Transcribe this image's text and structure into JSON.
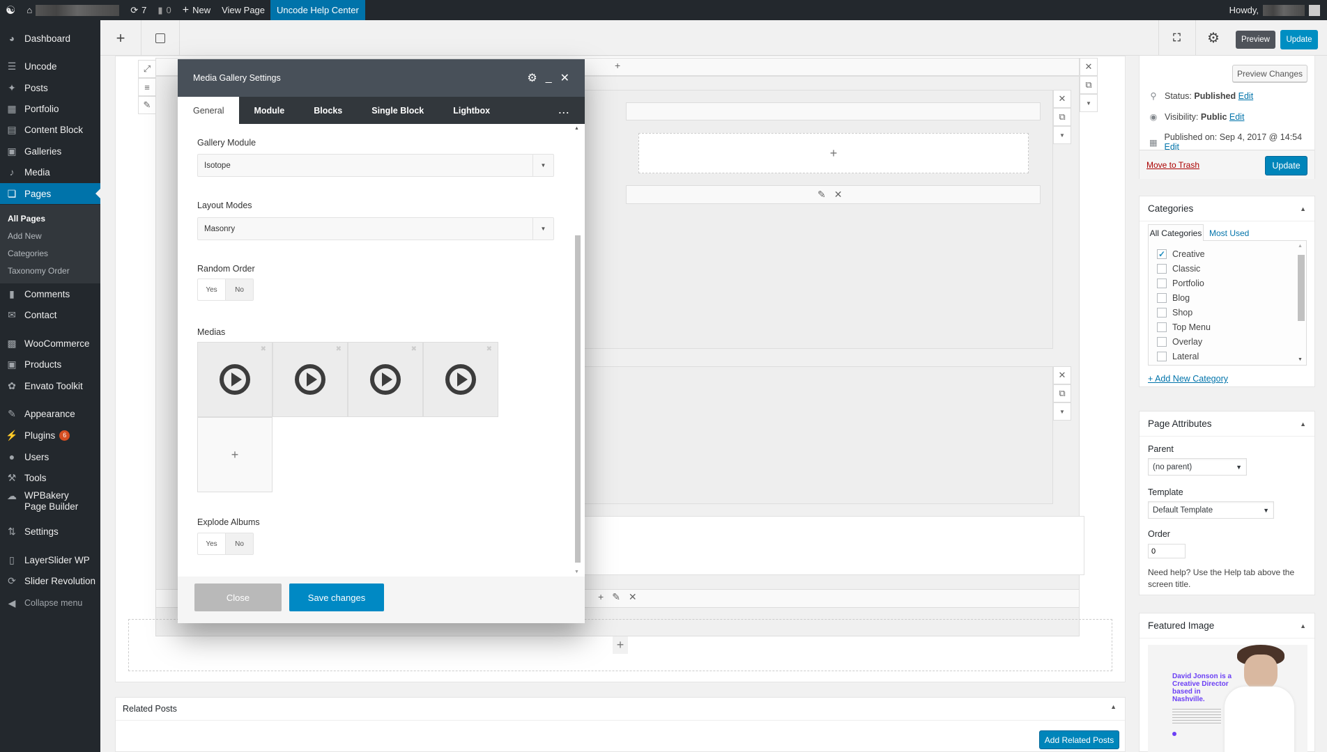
{
  "adminbar": {
    "updates_count": "7",
    "comments_count": "0",
    "new_label": "New",
    "view_page_label": "View Page",
    "help_center_label": "Uncode Help Center",
    "howdy_label": "Howdy,"
  },
  "sidebar": {
    "items": [
      {
        "label": "Dashboard",
        "icon": "dashboard-icon"
      },
      {
        "label": "Uncode",
        "icon": "layers-icon"
      },
      {
        "label": "Posts",
        "icon": "pin-icon"
      },
      {
        "label": "Portfolio",
        "icon": "portfolio-icon"
      },
      {
        "label": "Content Block",
        "icon": "content-block-icon"
      },
      {
        "label": "Galleries",
        "icon": "gallery-icon"
      },
      {
        "label": "Media",
        "icon": "media-icon"
      },
      {
        "label": "Pages",
        "icon": "pages-icon"
      },
      {
        "label": "Comments",
        "icon": "comment-icon"
      },
      {
        "label": "Contact",
        "icon": "mail-icon"
      },
      {
        "label": "WooCommerce",
        "icon": "woo-icon"
      },
      {
        "label": "Products",
        "icon": "box-icon"
      },
      {
        "label": "Envato Toolkit",
        "icon": "leaf-icon"
      },
      {
        "label": "Appearance",
        "icon": "brush-icon"
      },
      {
        "label": "Plugins",
        "icon": "plug-icon",
        "badge": "6"
      },
      {
        "label": "Users",
        "icon": "user-icon"
      },
      {
        "label": "Tools",
        "icon": "wrench-icon"
      },
      {
        "label": "WPBakery Page Builder",
        "icon": "cloud-icon"
      },
      {
        "label": "Settings",
        "icon": "settings-icon"
      },
      {
        "label": "LayerSlider WP",
        "icon": "slides-icon"
      },
      {
        "label": "Slider Revolution",
        "icon": "refresh-icon"
      }
    ],
    "submenu": [
      "All Pages",
      "Add New",
      "Categories",
      "Taxonomy Order"
    ],
    "collapse_label": "Collapse menu"
  },
  "toolbar": {
    "preview_label": "Preview",
    "update_label": "Update"
  },
  "modal": {
    "title": "Media Gallery Settings",
    "tabs": [
      "General",
      "Module",
      "Blocks",
      "Single Block",
      "Lightbox"
    ],
    "more_label": "...",
    "fields": {
      "gallery_module": {
        "label": "Gallery Module",
        "value": "Isotope"
      },
      "layout_modes": {
        "label": "Layout Modes",
        "value": "Masonry"
      },
      "random_order": {
        "label": "Random Order",
        "yes": "Yes",
        "no": "No",
        "selected": "No"
      },
      "medias": {
        "label": "Medias",
        "count": 4,
        "add_label": "+"
      },
      "explode_albums": {
        "label": "Explode Albums",
        "yes": "Yes",
        "no": "No",
        "selected": "No"
      }
    },
    "close_label": "Close",
    "save_label": "Save changes"
  },
  "publish": {
    "preview_changes_label": "Preview Changes",
    "status_label": "Status:",
    "status_value": "Published",
    "visibility_label": "Visibility:",
    "visibility_value": "Public",
    "published_on_label": "Published on:",
    "published_on_value": "Sep 4, 2017 @ 14:54",
    "edit_label": "Edit",
    "trash_label": "Move to Trash",
    "update_label": "Update"
  },
  "categories": {
    "title": "Categories",
    "tab_all": "All Categories",
    "tab_most_used": "Most Used",
    "items": [
      {
        "label": "Creative",
        "checked": true
      },
      {
        "label": "Classic",
        "checked": false
      },
      {
        "label": "Portfolio",
        "checked": false
      },
      {
        "label": "Blog",
        "checked": false
      },
      {
        "label": "Shop",
        "checked": false
      },
      {
        "label": "Top Menu",
        "checked": false
      },
      {
        "label": "Overlay",
        "checked": false
      },
      {
        "label": "Lateral",
        "checked": false
      }
    ],
    "add_new_label": "+ Add New Category"
  },
  "page_attributes": {
    "title": "Page Attributes",
    "parent_label": "Parent",
    "parent_value": "(no parent)",
    "template_label": "Template",
    "template_value": "Default Template",
    "order_label": "Order",
    "order_value": "0",
    "help_text": "Need help? Use the Help tab above the screen title."
  },
  "featured_image": {
    "title": "Featured Image",
    "headline": "David Jonson is a Creative Director based in Nashville."
  },
  "related_posts": {
    "title": "Related Posts",
    "add_label": "Add Related Posts"
  }
}
